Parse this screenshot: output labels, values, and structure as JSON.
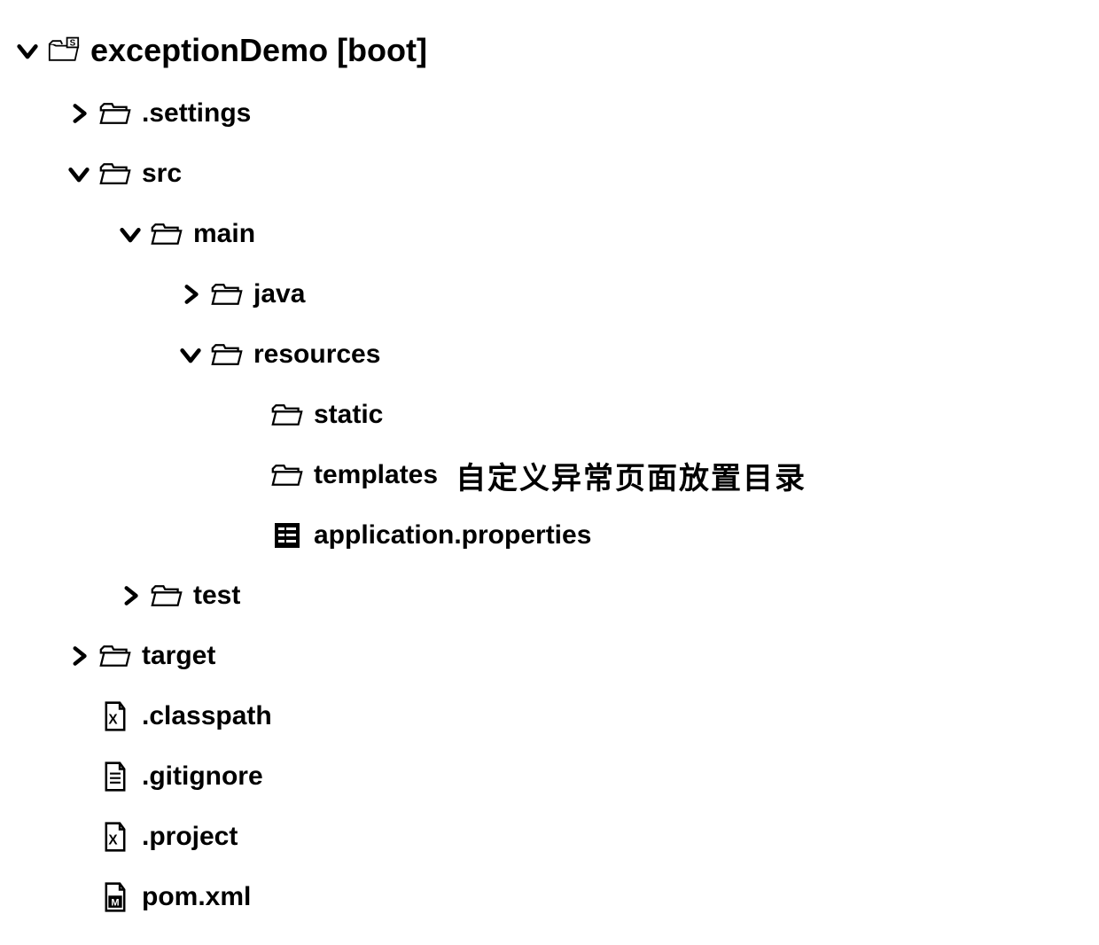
{
  "nodes": [
    {
      "id": "root",
      "indent": 0,
      "arrow": "down",
      "icon": "project",
      "label": "exceptionDemo [boot]",
      "root": true
    },
    {
      "id": "settings",
      "indent": 1,
      "arrow": "right",
      "icon": "folder",
      "label": ".settings"
    },
    {
      "id": "src",
      "indent": 1,
      "arrow": "down",
      "icon": "folder",
      "label": "src"
    },
    {
      "id": "main",
      "indent": 2,
      "arrow": "down",
      "icon": "folder",
      "label": "main"
    },
    {
      "id": "java",
      "indent": 3,
      "arrow": "right",
      "icon": "folder",
      "label": "java"
    },
    {
      "id": "resources",
      "indent": 3,
      "arrow": "down",
      "icon": "folder",
      "label": "resources"
    },
    {
      "id": "static",
      "indent": 4,
      "arrow": "none",
      "icon": "folder",
      "label": "static"
    },
    {
      "id": "templates",
      "indent": 4,
      "arrow": "none",
      "icon": "folder",
      "label": "templates",
      "annotation": "自定义异常页面放置目录"
    },
    {
      "id": "appprops",
      "indent": 4,
      "arrow": "none",
      "icon": "properties",
      "label": "application.properties"
    },
    {
      "id": "test",
      "indent": 2,
      "arrow": "right",
      "icon": "folder",
      "label": "test"
    },
    {
      "id": "target",
      "indent": 1,
      "arrow": "right",
      "icon": "folder",
      "label": "target"
    },
    {
      "id": "classpath",
      "indent": 1,
      "arrow": "none",
      "icon": "xfile",
      "label": ".classpath"
    },
    {
      "id": "gitignore",
      "indent": 1,
      "arrow": "none",
      "icon": "textfile",
      "label": ".gitignore"
    },
    {
      "id": "project",
      "indent": 1,
      "arrow": "none",
      "icon": "xfile",
      "label": ".project"
    },
    {
      "id": "pomxml",
      "indent": 1,
      "arrow": "none",
      "icon": "mfile",
      "label": "pom.xml"
    }
  ]
}
